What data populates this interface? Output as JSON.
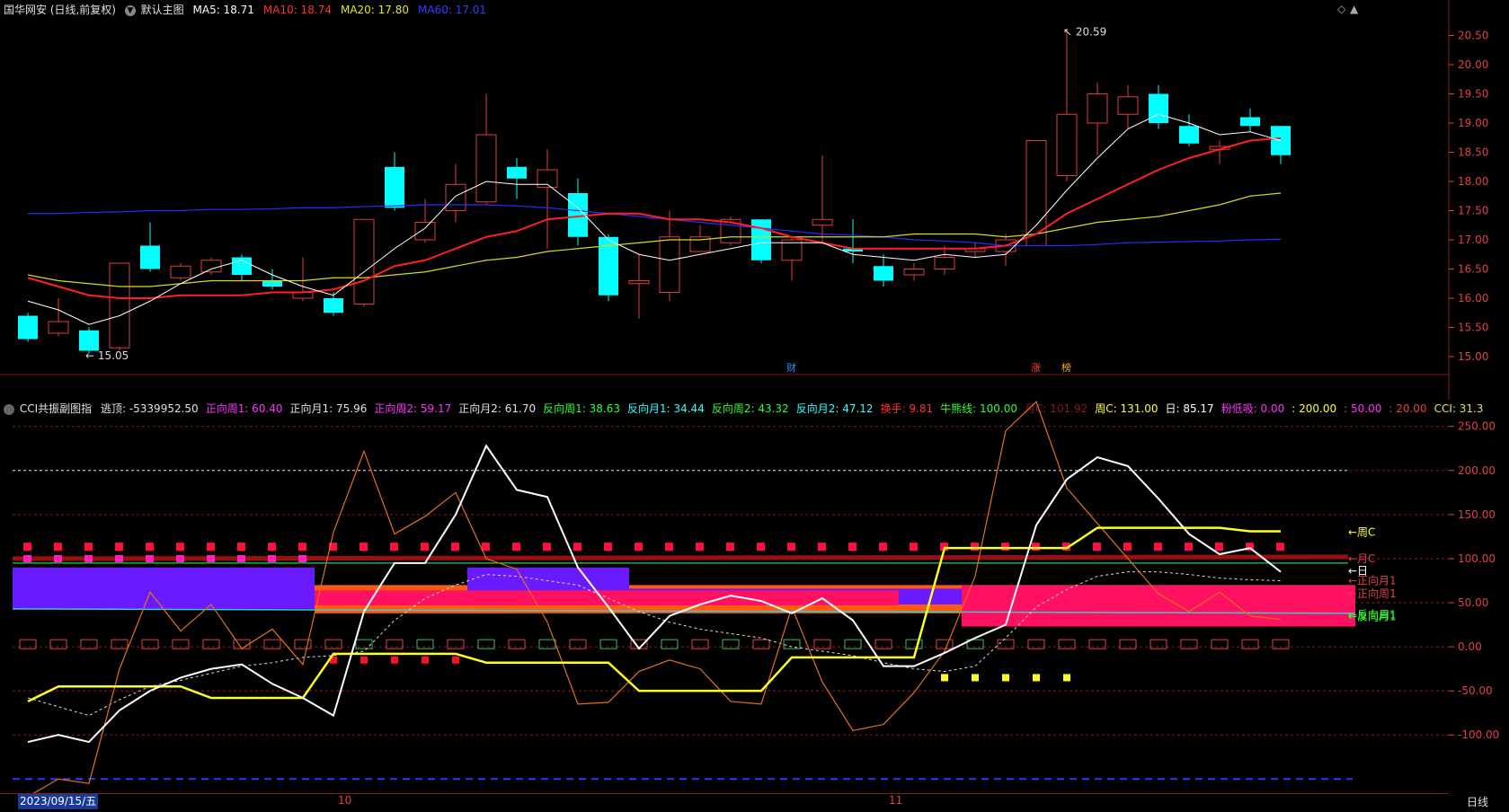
{
  "colors": {
    "bg": "#000000",
    "up": "#e03c3c",
    "down": "#00ffff",
    "ma5": "#ffffff",
    "ma10": "#ff2020",
    "ma20": "#d8d820",
    "ma60": "#2a2aff",
    "axis": "#e0404a",
    "grid": "#8a1a1a"
  },
  "main": {
    "title": "国华网安 (日线,前复权)",
    "dropdown_label": "默认主图",
    "ma": [
      {
        "label": "MA5: 18.71",
        "color": "#ffffff"
      },
      {
        "label": "MA10: 18.74",
        "color": "#ff3030"
      },
      {
        "label": "MA20: 17.80",
        "color": "#e6e620"
      },
      {
        "label": "MA60: 17.01",
        "color": "#3a3aff"
      }
    ],
    "ymin": 14.8,
    "ymax": 20.8,
    "yticks": [
      "20.50",
      "20.00",
      "19.50",
      "19.00",
      "18.50",
      "18.00",
      "17.50",
      "17.00",
      "16.50",
      "16.00",
      "15.50",
      "15.00"
    ],
    "high_mark": "20.59",
    "low_mark": "15.05",
    "markers": [
      "财",
      "涨",
      "榜"
    ],
    "candles": [
      [
        15.7,
        15.3,
        15.25,
        15.75
      ],
      [
        15.4,
        15.6,
        15.35,
        16.0
      ],
      [
        15.45,
        15.1,
        15.05,
        15.5
      ],
      [
        15.15,
        16.6,
        15.1,
        16.6
      ],
      [
        16.9,
        16.5,
        16.45,
        17.3
      ],
      [
        16.35,
        16.55,
        16.3,
        16.6
      ],
      [
        16.45,
        16.65,
        16.4,
        16.7
      ],
      [
        16.7,
        16.4,
        16.3,
        16.75
      ],
      [
        16.3,
        16.2,
        16.15,
        16.5
      ],
      [
        16.0,
        16.1,
        15.95,
        16.7
      ],
      [
        16.0,
        15.75,
        15.7,
        16.1
      ],
      [
        15.9,
        17.35,
        15.85,
        17.35
      ],
      [
        18.25,
        17.55,
        17.5,
        18.5
      ],
      [
        17.0,
        17.3,
        16.95,
        17.7
      ],
      [
        17.5,
        17.95,
        17.3,
        18.3
      ],
      [
        17.65,
        18.8,
        17.6,
        19.5
      ],
      [
        18.25,
        18.05,
        17.7,
        18.4
      ],
      [
        17.9,
        18.2,
        16.85,
        18.55
      ],
      [
        17.8,
        17.05,
        16.9,
        18.05
      ],
      [
        17.05,
        16.05,
        15.95,
        17.1
      ],
      [
        16.25,
        16.3,
        15.65,
        16.75
      ],
      [
        16.1,
        17.05,
        15.95,
        17.5
      ],
      [
        16.8,
        17.05,
        16.8,
        17.25
      ],
      [
        16.95,
        17.35,
        16.9,
        17.4
      ],
      [
        17.35,
        16.65,
        16.6,
        17.35
      ],
      [
        16.65,
        17.0,
        16.3,
        17.05
      ],
      [
        17.25,
        17.35,
        16.95,
        18.45
      ],
      [
        16.85,
        16.8,
        16.6,
        17.35
      ],
      [
        16.55,
        16.3,
        16.2,
        16.75
      ],
      [
        16.4,
        16.5,
        16.3,
        16.6
      ],
      [
        16.5,
        16.7,
        16.4,
        16.9
      ],
      [
        16.8,
        16.85,
        16.7,
        16.95
      ],
      [
        16.8,
        17.0,
        16.55,
        17.1
      ],
      [
        16.9,
        18.7,
        16.9,
        18.7
      ],
      [
        18.1,
        19.15,
        18.0,
        20.59
      ],
      [
        19.0,
        19.5,
        18.45,
        19.7
      ],
      [
        19.15,
        19.45,
        18.9,
        19.65
      ],
      [
        19.5,
        19.0,
        18.9,
        19.65
      ],
      [
        18.95,
        18.65,
        18.6,
        19.15
      ],
      [
        18.55,
        18.6,
        18.3,
        18.7
      ],
      [
        19.1,
        18.95,
        18.85,
        19.25
      ],
      [
        18.95,
        18.45,
        18.3,
        18.95
      ]
    ],
    "ma5_line": [
      15.95,
      15.8,
      15.55,
      15.7,
      15.95,
      16.25,
      16.5,
      16.65,
      16.4,
      16.2,
      16.05,
      16.45,
      16.85,
      17.2,
      17.75,
      18.0,
      17.95,
      17.95,
      17.55,
      17.0,
      16.75,
      16.65,
      16.75,
      16.85,
      16.95,
      16.95,
      16.95,
      16.75,
      16.7,
      16.65,
      16.75,
      16.7,
      16.75,
      17.25,
      17.85,
      18.4,
      18.9,
      19.15,
      19.0,
      18.8,
      18.85,
      18.7
    ],
    "ma10_line": [
      16.35,
      16.2,
      16.05,
      16.0,
      16.0,
      16.05,
      16.05,
      16.05,
      16.1,
      16.1,
      16.15,
      16.3,
      16.55,
      16.65,
      16.85,
      17.05,
      17.15,
      17.35,
      17.4,
      17.45,
      17.45,
      17.35,
      17.35,
      17.3,
      17.2,
      17.05,
      16.95,
      16.85,
      16.85,
      16.85,
      16.85,
      16.85,
      16.9,
      17.1,
      17.45,
      17.7,
      17.95,
      18.2,
      18.4,
      18.55,
      18.7,
      18.74
    ],
    "ma20_line": [
      16.4,
      16.3,
      16.25,
      16.2,
      16.2,
      16.25,
      16.3,
      16.3,
      16.3,
      16.3,
      16.35,
      16.35,
      16.4,
      16.45,
      16.55,
      16.65,
      16.7,
      16.8,
      16.85,
      16.9,
      16.95,
      17.0,
      17.0,
      17.05,
      17.05,
      17.05,
      17.05,
      17.05,
      17.05,
      17.1,
      17.1,
      17.1,
      17.05,
      17.1,
      17.2,
      17.3,
      17.35,
      17.4,
      17.5,
      17.6,
      17.75,
      17.8
    ],
    "ma60_line": [
      17.45,
      17.45,
      17.47,
      17.48,
      17.5,
      17.5,
      17.52,
      17.52,
      17.53,
      17.55,
      17.55,
      17.57,
      17.58,
      17.6,
      17.6,
      17.6,
      17.58,
      17.55,
      17.5,
      17.45,
      17.4,
      17.35,
      17.3,
      17.25,
      17.2,
      17.15,
      17.1,
      17.08,
      17.05,
      17.0,
      16.98,
      16.95,
      16.9,
      16.9,
      16.9,
      16.92,
      16.95,
      16.96,
      16.97,
      16.98,
      17.0,
      17.01
    ]
  },
  "sub": {
    "title": "CCI共振副图指",
    "items": [
      {
        "label": "逃顶: -5339952.50",
        "color": "#e0e0e0"
      },
      {
        "label": "正向周1: 60.40",
        "color": "#ff30ff"
      },
      {
        "label": "正向月1: 75.96",
        "color": "#e0e0e0"
      },
      {
        "label": "正向周2: 59.17",
        "color": "#ff30ff"
      },
      {
        "label": "正向月2: 61.70",
        "color": "#e0e0e0"
      },
      {
        "label": "反向周1: 38.63",
        "color": "#30ff30"
      },
      {
        "label": "反向月1: 34.44",
        "color": "#30ffff"
      },
      {
        "label": "反向周2: 43.32",
        "color": "#30ff30"
      },
      {
        "label": "反向月2: 47.12",
        "color": "#30ffff"
      },
      {
        "label": "换手: 9.81",
        "color": "#ff3030"
      },
      {
        "label": "牛熊线: 100.00",
        "color": "#30ff30"
      },
      {
        "label": "月C: 101.92",
        "color": "#8a1a1a"
      },
      {
        "label": "周C: 131.00",
        "color": "#ffff30"
      },
      {
        "label": "日: 85.17",
        "color": "#ffffff"
      },
      {
        "label": "粉低吸: 0.00",
        "color": "#ff30ff"
      },
      {
        "label": ": 200.00",
        "color": "#ffff30"
      },
      {
        "label": ": 50.00",
        "color": "#ff30ff"
      },
      {
        "label": ": 20.00",
        "color": "#e0404a"
      },
      {
        "label": "CCI: 31.3",
        "color": "#e0e060"
      }
    ],
    "ymin": -165,
    "ymax": 265,
    "yticks": [
      "250.00",
      "200.00",
      "150.00",
      "100.00",
      "50.00",
      "0.00",
      "-50.00",
      "-100.00"
    ],
    "right_labels": [
      "←周C",
      "←月C",
      "←日",
      "←正向月1",
      "←正向周1",
      "←反向周1",
      "←反向月1"
    ],
    "ri_line": [
      -108,
      -100,
      -108,
      -72,
      -50,
      -35,
      -25,
      -20,
      -42,
      -58,
      -78,
      40,
      95,
      95,
      150,
      228,
      178,
      170,
      90,
      45,
      -2,
      35,
      48,
      58,
      52,
      38,
      55,
      30,
      -22,
      -22,
      -7,
      10,
      25,
      138,
      190,
      215,
      205,
      168,
      128,
      105,
      112,
      85
    ],
    "zhouc_line": [
      -62,
      -45,
      -45,
      -45,
      -45,
      -45,
      -58,
      -58,
      -58,
      -58,
      -8,
      -8,
      -8,
      -8,
      -8,
      -18,
      -18,
      -18,
      -18,
      -18,
      -50,
      -50,
      -50,
      -50,
      -50,
      -12,
      -12,
      -12,
      -12,
      -12,
      112,
      112,
      112,
      112,
      112,
      135,
      135,
      135,
      135,
      135,
      131,
      131
    ],
    "cci_line": [
      -170,
      -150,
      -155,
      -25,
      62,
      18,
      48,
      -2,
      20,
      -20,
      130,
      222,
      128,
      148,
      175,
      100,
      88,
      28,
      -65,
      -63,
      -28,
      -15,
      -25,
      -62,
      -65,
      45,
      -40,
      -95,
      -88,
      -52,
      -5,
      80,
      245,
      278,
      180,
      140,
      100,
      60,
      40,
      62,
      35,
      31
    ],
    "dash_line": [
      -58,
      -68,
      -78,
      -60,
      -45,
      -38,
      -30,
      -22,
      -18,
      -12,
      -10,
      -5,
      30,
      55,
      70,
      82,
      80,
      75,
      70,
      55,
      40,
      28,
      20,
      15,
      10,
      0,
      -5,
      -10,
      -18,
      -25,
      -28,
      -22,
      10,
      45,
      65,
      80,
      85,
      85,
      82,
      78,
      76,
      75
    ]
  },
  "dates": {
    "first": "2023/09/15/五",
    "m10": "10",
    "m11": "11"
  },
  "period_label": "日线"
}
